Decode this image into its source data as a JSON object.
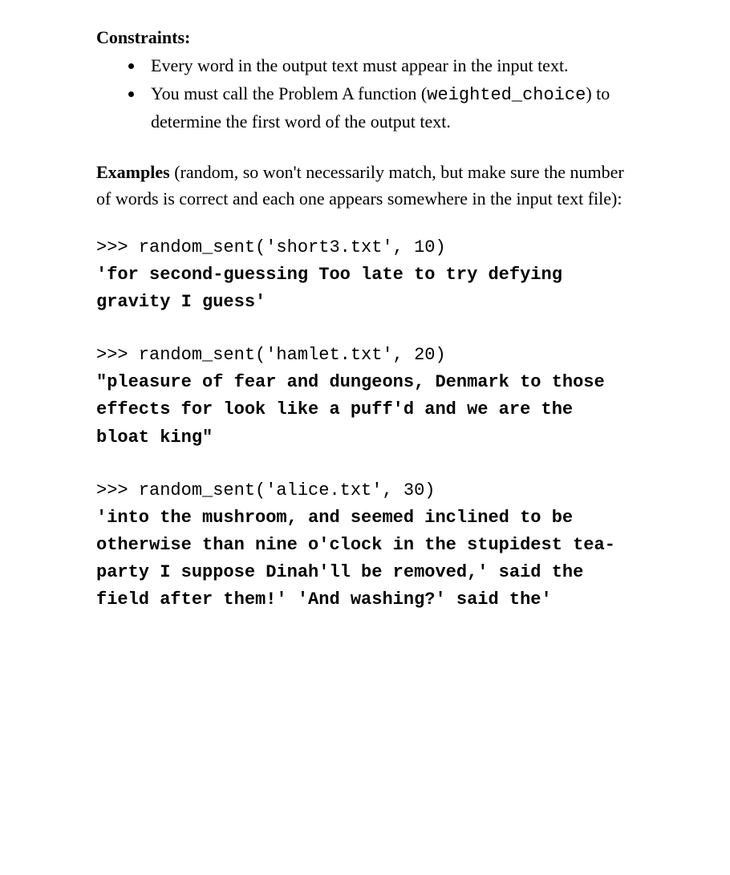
{
  "constraints_heading": "Constraints:",
  "constraints": [
    {
      "text_before": "Every word in the output text must appear in the input text.",
      "code": "",
      "text_after": ""
    },
    {
      "text_before": "You must call the Problem A function (",
      "code": "weighted_choice",
      "text_after": ") to determine the first word of the output text."
    }
  ],
  "examples_heading": "Examples",
  "examples_intro": " (random, so won't necessarily match, but make sure the number of words is correct and each one appears somewhere in the input text file):",
  "examples": [
    {
      "input": ">>> random_sent('short3.txt', 10)",
      "output": "'for second-guessing Too late to try defying gravity I guess'"
    },
    {
      "input": ">>> random_sent('hamlet.txt', 20)",
      "output": "\"pleasure of fear and dungeons, Denmark to those effects for look like a puff'd and we are the bloat king\""
    },
    {
      "input": ">>> random_sent('alice.txt', 30)",
      "output": "'into the mushroom, and seemed inclined to be otherwise than nine o'clock in the stupidest tea-party I suppose Dinah'll be removed,' said the field after them!' 'And washing?' said the'"
    }
  ]
}
